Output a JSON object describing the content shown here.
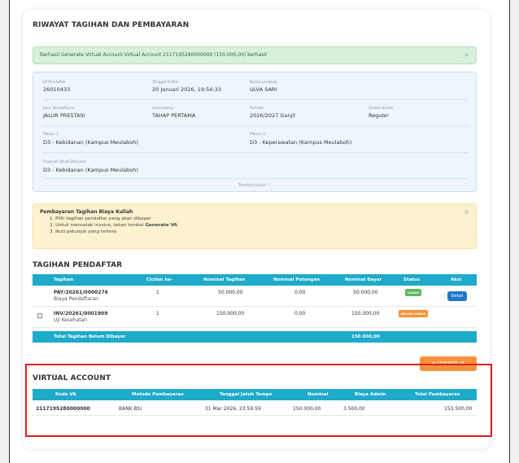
{
  "page_title": "RIWAYAT TAGIHAN DAN PEMBAYARAN",
  "success_alert": {
    "message": "Berhasil Generate Virtual Account Virtual Account 2117195280000000 (150.000,00) berhasil",
    "close": "×"
  },
  "info": {
    "id_label": "ID Pendaftar",
    "id_value": "26010433",
    "tgl_label": "Tanggal Daftar",
    "tgl_value": "20 Januari 2026, 19:54:33",
    "nama_label": "Nama Lengkap",
    "nama_value": "ULVA SARI",
    "jalur_label": "Jalur Pendaftaran",
    "jalur_value": "JALUR PRESTASI",
    "gelombang_label": "Gelombang",
    "gelombang_value": "TAHAP PERTAMA",
    "periode_label": "Periode",
    "periode_value": "2026/2027 Ganjil",
    "sistem_label": "Sistem Kuliah",
    "sistem_value": "Reguler",
    "pilihan1_label": "Pilihan 1",
    "pilihan1_value": "D3 - Kebidanan (Kampus Meulaboh)",
    "pilihan2_label": "Pilihan 2",
    "pilihan2_value": "D3 - Keperawatan (Kampus Meulaboh)",
    "prodi_label": "Program Studi Diterima",
    "prodi_value": "D3 - Kebidanan (Kampus Meulaboh)",
    "toggle": "Sembunyikan ⌃"
  },
  "warning_alert": {
    "title": "Pembayaran Tagihan Biaya Kuliah",
    "step1": "1. Pilih tagihan pendaftar yang akan dibayar",
    "step2_prefix": "2. Untuk mencetak invoice, tekan tombol ",
    "step2_bold": "Generate VA",
    "step3": "3. Ikuti petunjuk yang tertera",
    "close": "×"
  },
  "tagihan": {
    "title": "TAGIHAN PENDAFTAR",
    "headers": [
      "Tagihan",
      "Cicilan ke-",
      "Nominal Tagihan",
      "Nominal Potongan",
      "Nominal Bayar",
      "Status",
      "Aksi"
    ],
    "rows": [
      {
        "code": "PAY/20261/0000276",
        "desc": "Biaya Pendaftaran",
        "cicilan": "1",
        "tagihan": "50.000,00",
        "potongan": "0,00",
        "bayar": "50.000,00",
        "status": "LUNAS",
        "aksi": "Detail"
      },
      {
        "code": "INV/20261/0001909",
        "desc": "Uji Kesehatan",
        "cicilan": "1",
        "tagihan": "150.000,00",
        "potongan": "0,00",
        "bayar": "150.000,00",
        "status": "BELUM LUNAS",
        "aksi": ""
      }
    ],
    "total_label": "Total Tagihan Belum Dibayar",
    "total_value": "150.000,00",
    "generate_button": "⊕ GENERATE VA"
  },
  "virtual_account": {
    "title": "VIRTUAL ACCOUNT",
    "headers": [
      "Kode VA",
      "Metode Pembayaran",
      "Tanggal Jatuh Tempo",
      "Nominal",
      "Biaya Admin",
      "Total Pembayaran"
    ],
    "row": {
      "kode": "2117195280000000",
      "metode": "BANK BSI",
      "jatuh_tempo": "31 Mar 2026, 23:59:59",
      "nominal": "150.000,00",
      "admin": "3.500,00",
      "total": "153.500,00"
    }
  },
  "colors": {
    "table_header": "#1eaac9",
    "success_bg": "#d6f0db",
    "warn_bg": "#fdf2cf",
    "info_bg": "#eef6fb",
    "lunas": "#5cb85c",
    "belum_lunas": "#f7923a",
    "highlight": "#e01e1e"
  }
}
